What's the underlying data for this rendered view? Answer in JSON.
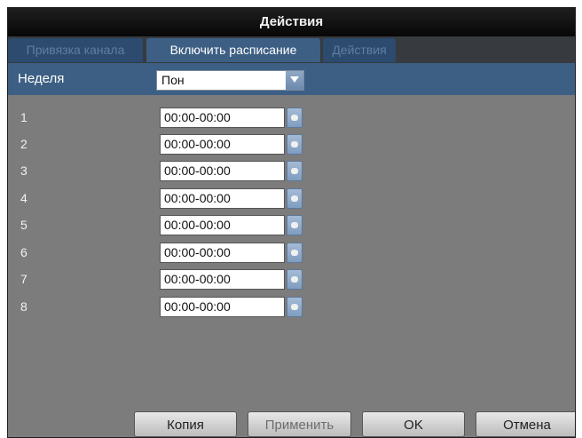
{
  "dialog": {
    "title": "Действия"
  },
  "tabs": [
    {
      "label": "Привязка канала",
      "active": false
    },
    {
      "label": "Включить расписание",
      "active": true
    },
    {
      "label": "Действия",
      "active": false
    }
  ],
  "week": {
    "label": "Неделя",
    "selected": "Пон"
  },
  "periods": [
    {
      "num": "1",
      "time": "00:00-00:00"
    },
    {
      "num": "2",
      "time": "00:00-00:00"
    },
    {
      "num": "3",
      "time": "00:00-00:00"
    },
    {
      "num": "4",
      "time": "00:00-00:00"
    },
    {
      "num": "5",
      "time": "00:00-00:00"
    },
    {
      "num": "6",
      "time": "00:00-00:00"
    },
    {
      "num": "7",
      "time": "00:00-00:00"
    },
    {
      "num": "8",
      "time": "00:00-00:00"
    }
  ],
  "buttons": {
    "copy": "Копия",
    "apply": "Применить",
    "ok": "OK",
    "cancel": "Отмена"
  },
  "colors": {
    "accent": "#3d5f84",
    "background": "#7c7c7c",
    "titlebar": "#0d0d0d"
  }
}
